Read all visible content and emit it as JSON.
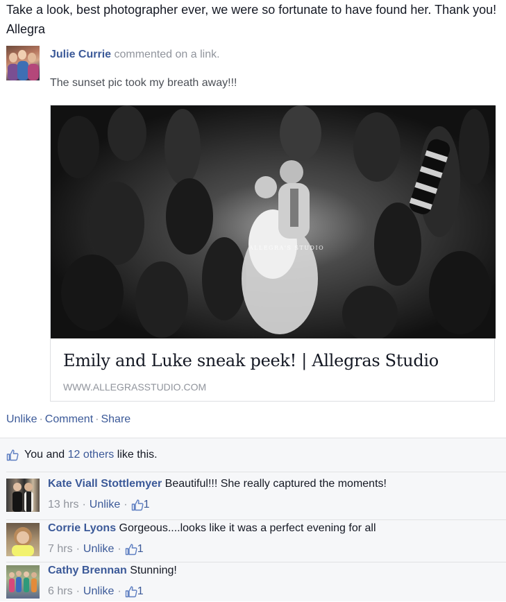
{
  "post": {
    "text": "Take a look, best photographer ever, we were so fortunate to have found her. Thank you! Allegra"
  },
  "story": {
    "actor": "Julie Currie",
    "verb": "commented on a link.",
    "message": "The sunset pic took my breath away!!!",
    "share": {
      "image_watermark": "ALLEGRA'S STUDIO",
      "title": "Emily and Luke sneak peek! | Allegras Studio",
      "domain": "WWW.ALLEGRASSTUDIO.COM"
    }
  },
  "actions": {
    "unlike": "Unlike",
    "comment": "Comment",
    "share": "Share",
    "separator": "·"
  },
  "likes": {
    "prefix": "You and",
    "others_link": "12 others",
    "suffix": "like this."
  },
  "comments": [
    {
      "author": "Kate Viall Stottlemyer",
      "text": "Beautiful!!! She really captured the moments!",
      "time": "13 hrs",
      "unlike": "Unlike",
      "like_count": "1"
    },
    {
      "author": "Corrie Lyons",
      "text": "Gorgeous....looks like it was a perfect evening for all",
      "time": "7 hrs",
      "unlike": "Unlike",
      "like_count": "1"
    },
    {
      "author": "Cathy Brennan",
      "text": "Stunning!",
      "time": "6 hrs",
      "unlike": "Unlike",
      "like_count": "1"
    }
  ],
  "colors": {
    "link": "#3b5998",
    "meta_gray": "#90949c",
    "ufi_background": "#f6f7f9"
  },
  "icons": [
    "like-thumb-icon"
  ]
}
